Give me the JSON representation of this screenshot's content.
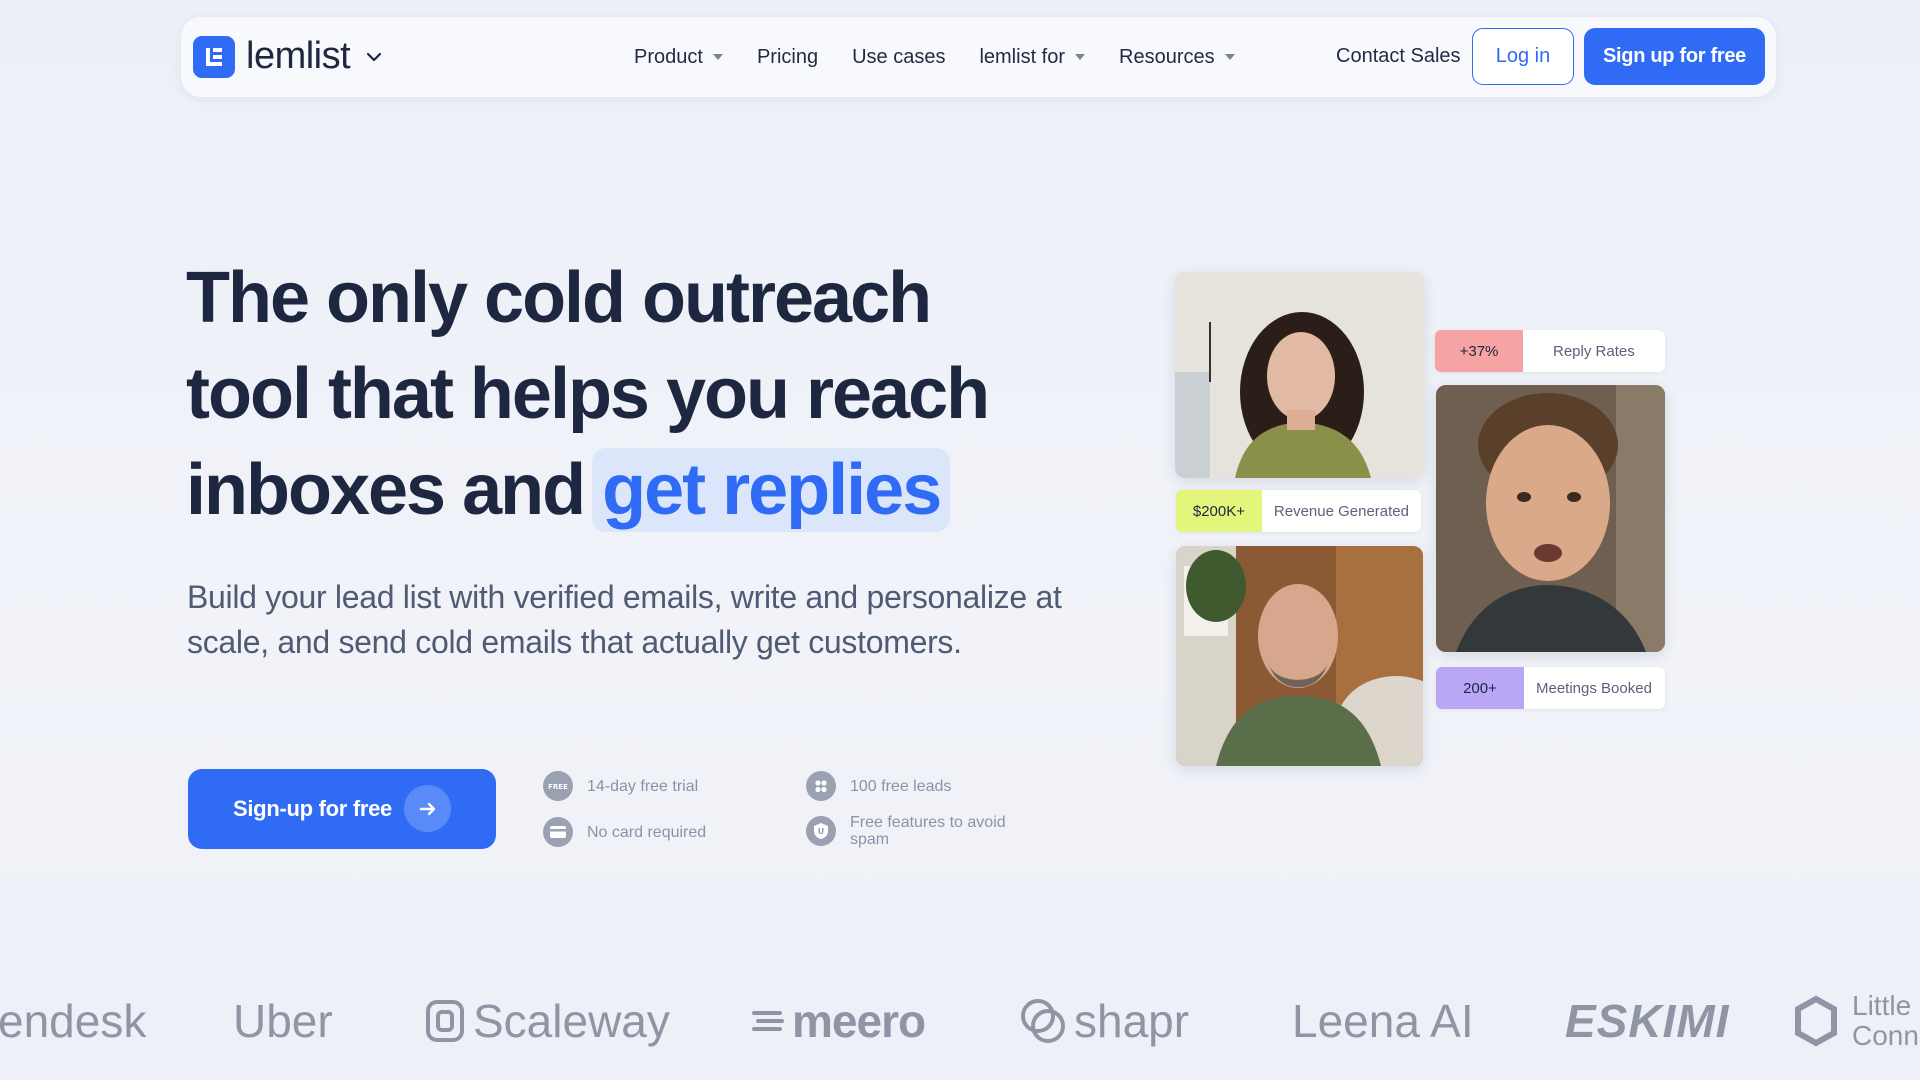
{
  "nav": {
    "brand": "lemlist",
    "links": [
      {
        "label": "Product",
        "dropdown": true
      },
      {
        "label": "Pricing",
        "dropdown": false
      },
      {
        "label": "Use cases",
        "dropdown": false
      },
      {
        "label": "lemlist for",
        "dropdown": true
      },
      {
        "label": "Resources",
        "dropdown": true
      }
    ],
    "contact_sales": "Contact Sales",
    "login": "Log in",
    "signup": "Sign up for free"
  },
  "hero": {
    "title_line1": "The only cold outreach",
    "title_line2": "tool that helps you reach",
    "title_line3_prefix": "inboxes and",
    "title_highlight": "get replies",
    "subtitle": "Build your lead list with verified emails, write and personalize at scale, and send cold emails that actually get customers.",
    "cta": "Sign-up for free",
    "features": [
      {
        "icon": "free-badge-icon",
        "text": "14-day free trial"
      },
      {
        "icon": "leads-icon",
        "text": "100 free leads"
      },
      {
        "icon": "card-icon",
        "text": "No card required"
      },
      {
        "icon": "shield-icon",
        "text": "Free features to avoid spam"
      }
    ]
  },
  "stats": [
    {
      "value": "+37%",
      "label": "Reply Rates",
      "color": "#f6a3a3"
    },
    {
      "value": "$200K+",
      "label": "Revenue Generated",
      "color": "#e3f57a"
    },
    {
      "value": "200+",
      "label": "Meetings Booked",
      "color": "#b9a6f5"
    }
  ],
  "logos": [
    "endesk",
    "Uber",
    "Scaleway",
    "meero",
    "shapr",
    "Leena AI",
    "ESKIMI",
    "Little Conn"
  ],
  "colors": {
    "primary": "#2f6bf5",
    "heading": "#1d2740",
    "highlight_bg": "#dbe6fb"
  }
}
